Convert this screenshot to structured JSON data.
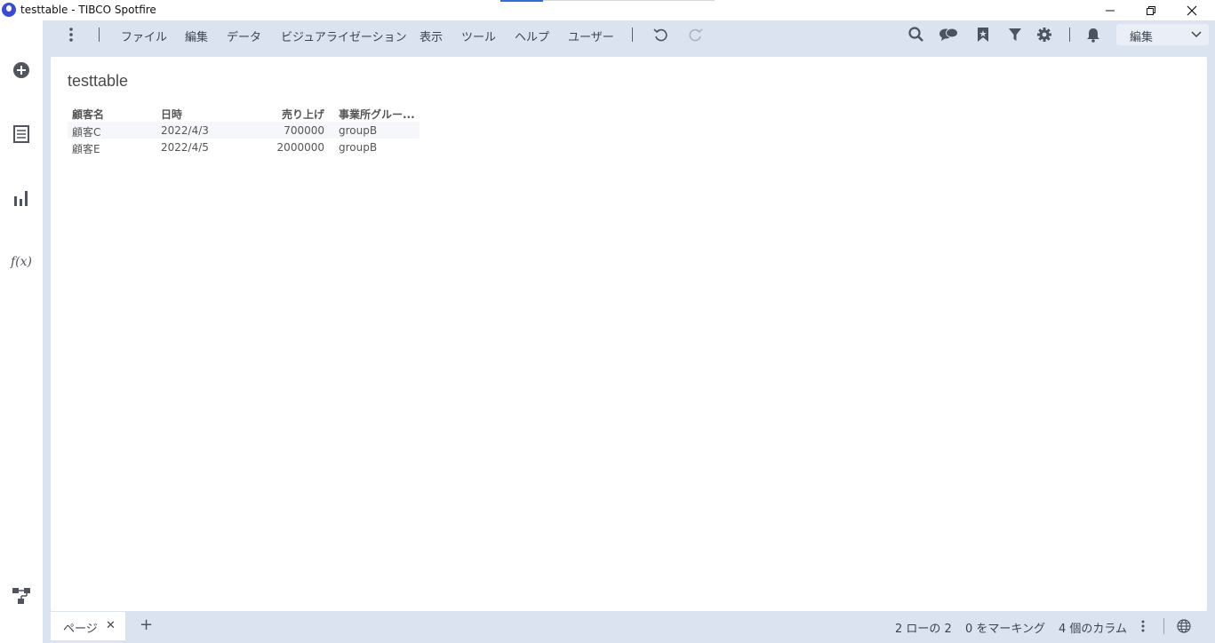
{
  "window": {
    "title": "testtable - TIBCO Spotfire",
    "minimize": "—",
    "maximize": "❐",
    "close": "✕"
  },
  "leftrail": {
    "items": [
      {
        "name": "add-data-icon"
      },
      {
        "name": "data-table-icon"
      },
      {
        "name": "visualization-icon"
      },
      {
        "name": "function-icon",
        "label": "f(x)"
      },
      {
        "name": "data-flow-icon"
      }
    ]
  },
  "toolbar": {
    "menu": [
      "ファイル",
      "編集",
      "データ",
      "ビジュアライゼーション",
      "表示",
      "ツール",
      "ヘルプ",
      "ユーザー"
    ],
    "mode": "編集"
  },
  "visualization": {
    "title": "testtable",
    "columns": [
      "顧客名",
      "日時",
      "売り上げ",
      "事業所グルー..."
    ],
    "rows": [
      [
        "顧客C",
        "2022/4/3",
        "700000",
        "groupB"
      ],
      [
        "顧客E",
        "2022/4/5",
        "2000000",
        "groupB"
      ]
    ]
  },
  "bottombar": {
    "page_tab": "ページ",
    "page_tab_close": "✕",
    "add_page": "+",
    "rows_status": "2 ローの 2",
    "marking_status": "0 をマーキング",
    "columns_status": "4 個のカラム"
  },
  "colors": {
    "frame": "#dbe3f1",
    "canvas": "#ffffff",
    "logo": "#3c4bd0",
    "accent": "#2f6fd6"
  }
}
